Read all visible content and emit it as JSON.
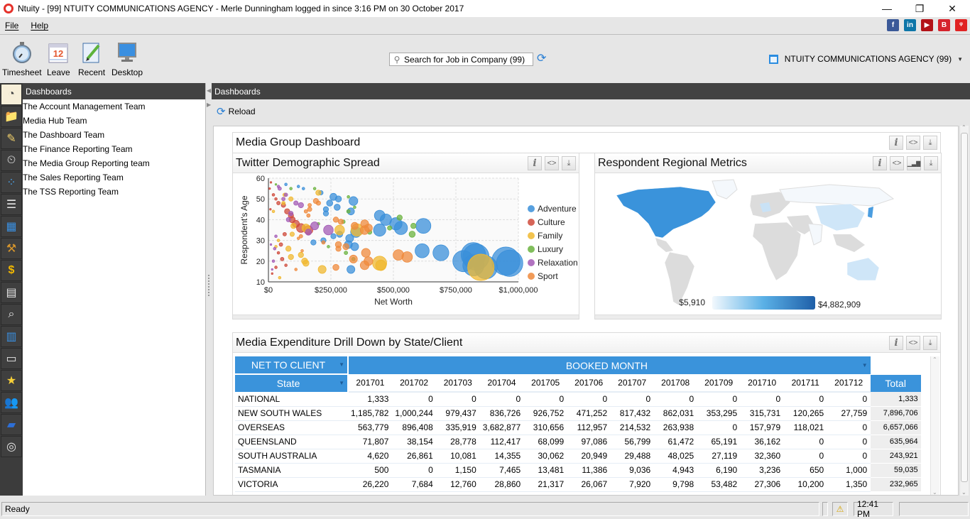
{
  "window": {
    "title": "Ntuity -  [99]  NTUITY COMMUNICATIONS AGENCY  - Merle Dunningham logged in since 3:16 PM on 30 October 2017",
    "controls": {
      "minimize": "—",
      "restore": "❐",
      "close": "✕"
    }
  },
  "menubar": {
    "items": [
      {
        "label": "File",
        "icon": null
      },
      {
        "label": "Help",
        "icon": null
      }
    ],
    "social": [
      {
        "name": "facebook-icon",
        "glyph": "f",
        "color": "#3b5998"
      },
      {
        "name": "linkedin-icon",
        "glyph": "in",
        "color": "#0e76a8"
      },
      {
        "name": "youtube-icon",
        "glyph": "▶",
        "color": "#b31217"
      },
      {
        "name": "blog-icon",
        "glyph": "B",
        "color": "#d6232c"
      },
      {
        "name": "brand-icon",
        "glyph": "ᵠ",
        "color": "#e02323"
      }
    ]
  },
  "toolbar": {
    "buttons": [
      {
        "label": "Timesheet",
        "icon": "stopwatch-icon"
      },
      {
        "label": "Leave",
        "icon": "calendar-icon"
      },
      {
        "label": "Recent",
        "icon": "document-edit-icon"
      },
      {
        "label": "Desktop",
        "icon": "monitor-icon"
      }
    ],
    "search": {
      "placeholder": "Search for Job in Company (99)",
      "value": ""
    },
    "company_selector": "NTUITY COMMUNICATIONS AGENCY (99)"
  },
  "sidebar": {
    "header": "Dashboards",
    "icons": [
      "dashboard-gauge-icon",
      "folder-icon",
      "notes-edit-icon",
      "calendar-clock-icon",
      "grid-dots-icon",
      "list-document-icon",
      "calendar-grid-icon",
      "tools-icon",
      "dollar-coin-icon",
      "address-book-icon",
      "search-document-icon",
      "report-layout-icon",
      "cards-icon",
      "star-icon",
      "users-icon",
      "book-icon",
      "dials-icon"
    ],
    "items": [
      "The Account Management Team",
      "Media Hub Team",
      "The Dashboard Team",
      "The Finance Reporting Team",
      "The Media Group Reporting team",
      "The Sales Reporting Team",
      "The TSS Reporting Team"
    ]
  },
  "main": {
    "header": "Dashboards",
    "reload_label": "Reload",
    "dashboard_title": "Media Group Dashboard",
    "widget_buttons": {
      "info": "i",
      "embed": "<>",
      "download": "⤓",
      "chart": "▁▃▇"
    },
    "scatter_title": "Twitter Demographic Spread",
    "map_title": "Respondent Regional Metrics",
    "map_legend": {
      "min": "$5,910",
      "max": "$4,882,909",
      "low_color": "#e8f3fb",
      "high_color": "#1f5fa8"
    },
    "pivot_title": "Media Expenditure Drill Down by State/Client"
  },
  "chart_data": [
    {
      "type": "scatter",
      "title": "Twitter Demographic Spread",
      "xlabel": "Net Worth",
      "ylabel": "Respondent's Age",
      "xlim": [
        0,
        1000000
      ],
      "ylim": [
        10,
        60
      ],
      "xticks": [
        "$0",
        "$250,000",
        "$500,000",
        "$750,000",
        "$1,000,000"
      ],
      "yticks": [
        "10",
        "20",
        "30",
        "40",
        "50",
        "60"
      ],
      "grid": true,
      "legend": "right",
      "series": [
        {
          "name": "Adventure",
          "color": "#3a8fd9",
          "points": [
            [
              950000,
              20,
              32
            ],
            [
              965000,
              19,
              30
            ],
            [
              830000,
              22,
              30
            ],
            [
              820000,
              23,
              28
            ],
            [
              870000,
              17,
              26
            ],
            [
              780000,
              20,
              24
            ],
            [
              820000,
              18,
              24
            ],
            [
              690000,
              24,
              18
            ],
            [
              615000,
              25,
              16
            ],
            [
              620000,
              37,
              17
            ],
            [
              530000,
              36,
              15
            ],
            [
              510000,
              38,
              14
            ],
            [
              470000,
              40,
              13
            ],
            [
              445000,
              42,
              12
            ],
            [
              445000,
              35,
              14
            ],
            [
              350000,
              34,
              12
            ],
            [
              345000,
              27,
              9
            ],
            [
              320000,
              28,
              9
            ],
            [
              325000,
              31,
              9
            ],
            [
              340000,
              49,
              10
            ],
            [
              330000,
              44,
              8
            ],
            [
              260000,
              51,
              8
            ],
            [
              275000,
              46,
              7
            ],
            [
              280000,
              50,
              7
            ],
            [
              245000,
              48,
              7
            ],
            [
              230000,
              45,
              6
            ],
            [
              230000,
              43,
              6
            ],
            [
              260000,
              32,
              6
            ],
            [
              285000,
              33,
              7
            ],
            [
              180000,
              29,
              6
            ],
            [
              220000,
              30,
              6
            ],
            [
              330000,
              16,
              9
            ],
            [
              210000,
              53,
              5
            ],
            [
              120000,
              56,
              3
            ],
            [
              140000,
              55,
              3
            ],
            [
              70000,
              57,
              3
            ]
          ]
        },
        {
          "name": "Culture",
          "color": "#cf4a3b",
          "points": [
            [
              160000,
              35,
              10
            ],
            [
              130000,
              36,
              10
            ],
            [
              110000,
              38,
              8
            ],
            [
              95000,
              40,
              7
            ],
            [
              90000,
              42,
              6
            ],
            [
              75000,
              44,
              6
            ],
            [
              60000,
              47,
              5
            ],
            [
              40000,
              48,
              4
            ],
            [
              20000,
              52,
              3
            ],
            [
              30000,
              50,
              3
            ],
            [
              65000,
              33,
              4
            ],
            [
              50000,
              28,
              4
            ],
            [
              40000,
              24,
              3
            ],
            [
              55000,
              21,
              4
            ],
            [
              30000,
              17,
              3
            ],
            [
              70000,
              18,
              3
            ],
            [
              15000,
              14,
              2
            ],
            [
              10000,
              58,
              2
            ],
            [
              5000,
              55,
              2
            ],
            [
              8000,
              45,
              2
            ]
          ]
        },
        {
          "name": "Family",
          "color": "#f0b830",
          "points": [
            [
              850000,
              17,
              30
            ],
            [
              445000,
              19,
              16
            ],
            [
              450000,
              18,
              12
            ],
            [
              355000,
              35,
              14
            ],
            [
              285000,
              35,
              11
            ],
            [
              150000,
              36,
              9
            ],
            [
              215000,
              16,
              9
            ],
            [
              145000,
              20,
              7
            ],
            [
              150000,
              19,
              7
            ],
            [
              130000,
              23,
              6
            ],
            [
              90000,
              22,
              6
            ],
            [
              80000,
              26,
              6
            ],
            [
              100000,
              37,
              6
            ],
            [
              95000,
              33,
              5
            ],
            [
              90000,
              50,
              5
            ],
            [
              65000,
              52,
              4
            ],
            [
              60000,
              48,
              4
            ],
            [
              200000,
              53,
              6
            ],
            [
              40000,
              30,
              3
            ],
            [
              30000,
              27,
              3
            ],
            [
              45000,
              12,
              3
            ],
            [
              20000,
              44,
              3
            ]
          ]
        },
        {
          "name": "Luxury",
          "color": "#6bb33f",
          "points": [
            [
              575000,
              33,
              7
            ],
            [
              580000,
              37,
              6
            ],
            [
              525000,
              41,
              6
            ],
            [
              485000,
              36,
              5
            ],
            [
              405000,
              34,
              5
            ],
            [
              320000,
              44,
              4
            ],
            [
              345000,
              46,
              3
            ],
            [
              320000,
              51,
              3
            ],
            [
              300000,
              39,
              4
            ],
            [
              310000,
              24,
              4
            ],
            [
              340000,
              21,
              4
            ],
            [
              240000,
              27,
              3
            ],
            [
              185000,
              55,
              3
            ],
            [
              200000,
              38,
              3
            ],
            [
              90000,
              55,
              3
            ],
            [
              30000,
              57,
              2
            ]
          ]
        },
        {
          "name": "Relaxation",
          "color": "#a35bb5",
          "points": [
            [
              240000,
              35,
              11
            ],
            [
              185000,
              37,
              9
            ],
            [
              160000,
              34,
              7
            ],
            [
              130000,
              47,
              6
            ],
            [
              110000,
              48,
              5
            ],
            [
              90000,
              43,
              5
            ],
            [
              80000,
              40,
              5
            ],
            [
              70000,
              52,
              4
            ],
            [
              60000,
              50,
              4
            ],
            [
              45000,
              55,
              4
            ],
            [
              40000,
              56,
              3
            ],
            [
              30000,
              32,
              3
            ],
            [
              25000,
              26,
              3
            ],
            [
              20000,
              20,
              3
            ],
            [
              15000,
              16,
              2
            ],
            [
              10000,
              28,
              2
            ]
          ]
        },
        {
          "name": "Sport",
          "color": "#ef8a3c",
          "points": [
            [
              520000,
              23,
              12
            ],
            [
              555000,
              22,
              12
            ],
            [
              385000,
              18,
              10
            ],
            [
              400000,
              20,
              10
            ],
            [
              390000,
              24,
              10
            ],
            [
              340000,
              21,
              9
            ],
            [
              385000,
              38,
              9
            ],
            [
              385000,
              35,
              10
            ],
            [
              400000,
              36,
              9
            ],
            [
              345000,
              37,
              8
            ],
            [
              310000,
              27,
              7
            ],
            [
              280000,
              28,
              7
            ],
            [
              280000,
              26,
              6
            ],
            [
              270000,
              17,
              7
            ],
            [
              290000,
              39,
              6
            ],
            [
              270000,
              40,
              6
            ],
            [
              190000,
              49,
              6
            ],
            [
              200000,
              48,
              5
            ],
            [
              165000,
              45,
              5
            ],
            [
              160000,
              42,
              4
            ],
            [
              150000,
              44,
              4
            ],
            [
              130000,
              32,
              4
            ],
            [
              135000,
              25,
              3
            ],
            [
              120000,
              31,
              3
            ],
            [
              165000,
              47,
              4
            ],
            [
              220000,
              29,
              4
            ],
            [
              110000,
              16,
              3
            ]
          ]
        }
      ]
    },
    {
      "type": "heatmap",
      "title": "Respondent Regional Metrics",
      "colorscale": {
        "min": 5910,
        "max": 4882909,
        "min_label": "$5,910",
        "max_label": "$4,882,909"
      },
      "regions_highlighted": [
        {
          "region": "United States",
          "level": "high"
        },
        {
          "region": "Canada",
          "level": "high"
        },
        {
          "region": "China",
          "level": "low"
        },
        {
          "region": "Australia",
          "level": "low"
        },
        {
          "region": "Japan",
          "level": "medium"
        },
        {
          "region": "Central Europe",
          "level": "low"
        }
      ]
    },
    {
      "type": "table",
      "title": "Media Expenditure Drill Down by State/Client",
      "measure": "NET TO CLIENT",
      "column_dimension": "BOOKED MONTH",
      "row_dimension": "State",
      "columns": [
        "201701",
        "201702",
        "201703",
        "201704",
        "201705",
        "201706",
        "201707",
        "201708",
        "201709",
        "201710",
        "201711",
        "201712"
      ],
      "total_label": "Total",
      "rows": [
        {
          "label": "NATIONAL",
          "values": [
            "1,333",
            "0",
            "0",
            "0",
            "0",
            "0",
            "0",
            "0",
            "0",
            "0",
            "0",
            "0"
          ],
          "total": "1,333"
        },
        {
          "label": "NEW SOUTH WALES",
          "values": [
            "1,185,782",
            "1,000,244",
            "979,437",
            "836,726",
            "926,752",
            "471,252",
            "817,432",
            "862,031",
            "353,295",
            "315,731",
            "120,265",
            "27,759"
          ],
          "total": "7,896,706"
        },
        {
          "label": "OVERSEAS",
          "values": [
            "563,779",
            "896,408",
            "335,919",
            "3,682,877",
            "310,656",
            "112,957",
            "214,532",
            "263,938",
            "0",
            "157,979",
            "118,021",
            "0"
          ],
          "total": "6,657,066"
        },
        {
          "label": "QUEENSLAND",
          "values": [
            "71,807",
            "38,154",
            "28,778",
            "112,417",
            "68,099",
            "97,086",
            "56,799",
            "61,472",
            "65,191",
            "36,162",
            "0",
            "0"
          ],
          "total": "635,964"
        },
        {
          "label": "SOUTH AUSTRALIA",
          "values": [
            "4,620",
            "26,861",
            "10,081",
            "14,355",
            "30,062",
            "20,949",
            "29,488",
            "48,025",
            "27,119",
            "32,360",
            "0",
            "0"
          ],
          "total": "243,921"
        },
        {
          "label": "TASMANIA",
          "values": [
            "500",
            "0",
            "1,150",
            "7,465",
            "13,481",
            "11,386",
            "9,036",
            "4,943",
            "6,190",
            "3,236",
            "650",
            "1,000"
          ],
          "total": "59,035"
        },
        {
          "label": "VICTORIA",
          "values": [
            "26,220",
            "7,684",
            "12,760",
            "28,860",
            "21,317",
            "26,067",
            "7,920",
            "9,798",
            "53,482",
            "27,306",
            "10,200",
            "1,350"
          ],
          "total": "232,965"
        }
      ]
    }
  ],
  "statusbar": {
    "status": "Ready",
    "time": "12:41 PM",
    "warning_icon": "⚠"
  }
}
